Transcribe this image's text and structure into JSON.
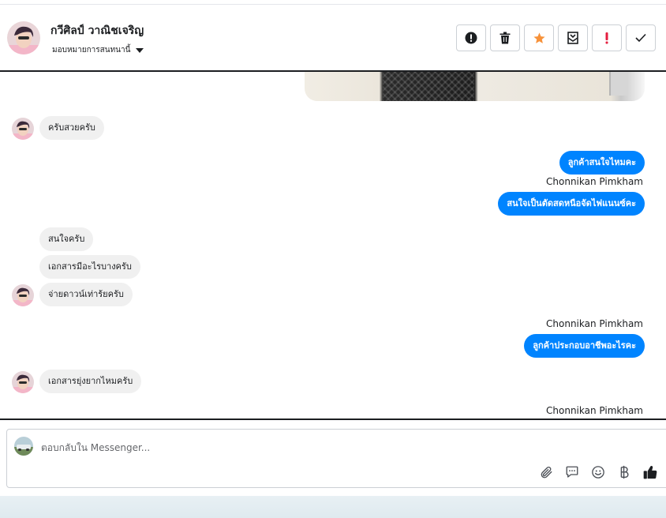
{
  "header": {
    "contact_name": "กวีศิลป์ วาณิชเจริญ",
    "assign_label": "มอบหมายการสนทนานี้",
    "actions": [
      {
        "icon": "alert-circle-icon"
      },
      {
        "icon": "trash-icon"
      },
      {
        "icon": "star-icon",
        "color": "#f7923a"
      },
      {
        "icon": "mark-unread-icon"
      },
      {
        "icon": "exclamation-icon",
        "color": "#e41e3f"
      },
      {
        "icon": "check-icon"
      }
    ]
  },
  "messages": {
    "m1": "ครับสวยครับ",
    "m2": "ลูกค้าสนใจไหมคะ",
    "sender1": "Chonnikan Pimkham",
    "m3": "สนใจเป็นตัดสดหนือจัดไฟแนนซ์คะ",
    "m4": "สนใจครับ",
    "m5": "เอกสารมีอะไรบางครับ",
    "m6": "จ่ายดาวน์เท่าร้ยครับ",
    "sender2": "Chonnikan Pimkham",
    "m7": "ลูกค้าประกอบอาชีพอะไรคะ",
    "m8": "เอกสารยุ่งยากไหมครับ",
    "sender3": "Chonnikan Pimkham"
  },
  "composer": {
    "placeholder": "ตอบกลับใน Messenger..."
  },
  "colors": {
    "outgoing_bubble": "#0084ff",
    "incoming_bubble": "#f0f0f0",
    "star": "#f7923a",
    "alert": "#e41e3f"
  }
}
